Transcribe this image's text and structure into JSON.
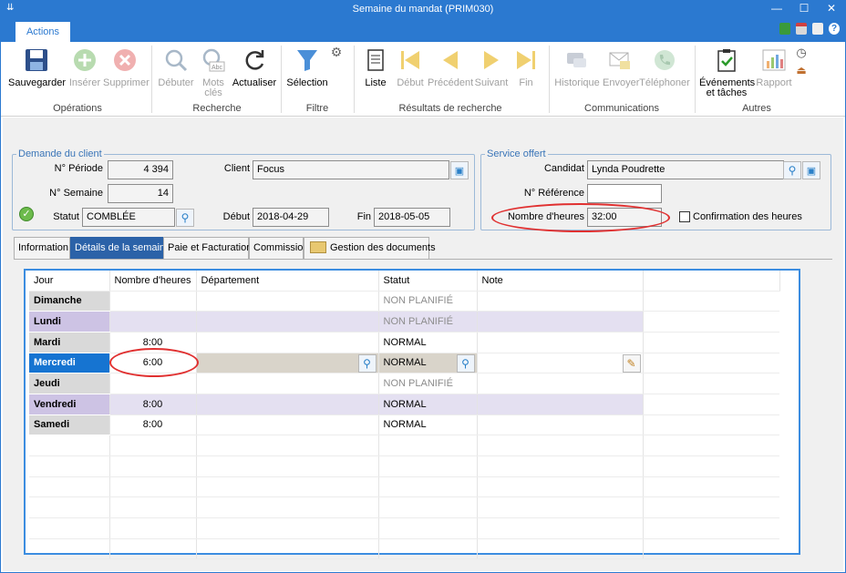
{
  "window": {
    "title": "Semaine du mandat (PRIM030)",
    "menu_glyph": "⇊"
  },
  "ribbon": {
    "tab_actions": "Actions",
    "groups": {
      "operations": "Opérations",
      "recherche": "Recherche",
      "filtre": "Filtre",
      "resultats": "Résultats de recherche",
      "communications": "Communications",
      "autres": "Autres"
    },
    "buttons": {
      "sauvegarder": "Sauvegarder",
      "inserer": "Insérer",
      "supprimer": "Supprimer",
      "debuter": "Débuter",
      "mots_cles_1": "Mots",
      "mots_cles_2": "clés",
      "actualiser": "Actualiser",
      "selection": "Sélection",
      "liste": "Liste",
      "debut": "Début",
      "precedent": "Précédent",
      "suivant": "Suivant",
      "fin": "Fin",
      "historique": "Historique",
      "envoyer": "Envoyer",
      "telephoner": "Téléphoner",
      "evenements_1": "Événements",
      "evenements_2": "et tâches",
      "rapport": "Rapport"
    }
  },
  "demande": {
    "legend": "Demande du client",
    "periode_label": "N° Période",
    "periode_value": "4 394",
    "semaine_label": "N° Semaine",
    "semaine_value": "14",
    "statut_label": "Statut",
    "statut_value": "COMBLÉE",
    "client_label": "Client",
    "client_value": "Focus",
    "debut_label": "Début",
    "debut_value": "2018-04-29",
    "fin_label": "Fin",
    "fin_value": "2018-05-05"
  },
  "service": {
    "legend": "Service offert",
    "candidat_label": "Candidat",
    "candidat_value": "Lynda Poudrette",
    "reference_label": "N° Référence",
    "reference_value": "",
    "heures_label": "Nombre d'heures",
    "heures_value": "32:00",
    "confirmation_label": "Confirmation des heures"
  },
  "tabs": [
    "Information",
    "Détails de la semaine",
    "Paie et Facturation",
    "Commission",
    "Gestion des documents"
  ],
  "grid": {
    "headers": [
      "Jour",
      "Nombre d'heures",
      "Département",
      "Statut",
      "Note"
    ],
    "rows": [
      {
        "jour": "Dimanche",
        "heures": "",
        "departement": "",
        "statut": "NON PLANIFIÉ",
        "note": ""
      },
      {
        "jour": "Lundi",
        "heures": "",
        "departement": "",
        "statut": "NON PLANIFIÉ",
        "note": ""
      },
      {
        "jour": "Mardi",
        "heures": "8:00",
        "departement": "",
        "statut": "NORMAL",
        "note": ""
      },
      {
        "jour": "Mercredi",
        "heures": "6:00",
        "departement": "",
        "statut": "NORMAL",
        "note": ""
      },
      {
        "jour": "Jeudi",
        "heures": "",
        "departement": "",
        "statut": "NON PLANIFIÉ",
        "note": ""
      },
      {
        "jour": "Vendredi",
        "heures": "8:00",
        "departement": "",
        "statut": "NORMAL",
        "note": ""
      },
      {
        "jour": "Samedi",
        "heures": "8:00",
        "departement": "",
        "statut": "NORMAL",
        "note": ""
      }
    ]
  },
  "colors": {
    "accent": "#2b79d0",
    "selected_row": "#1674d1",
    "alt_row": "#e4e0f1",
    "highlight_oval": "#e03030"
  }
}
